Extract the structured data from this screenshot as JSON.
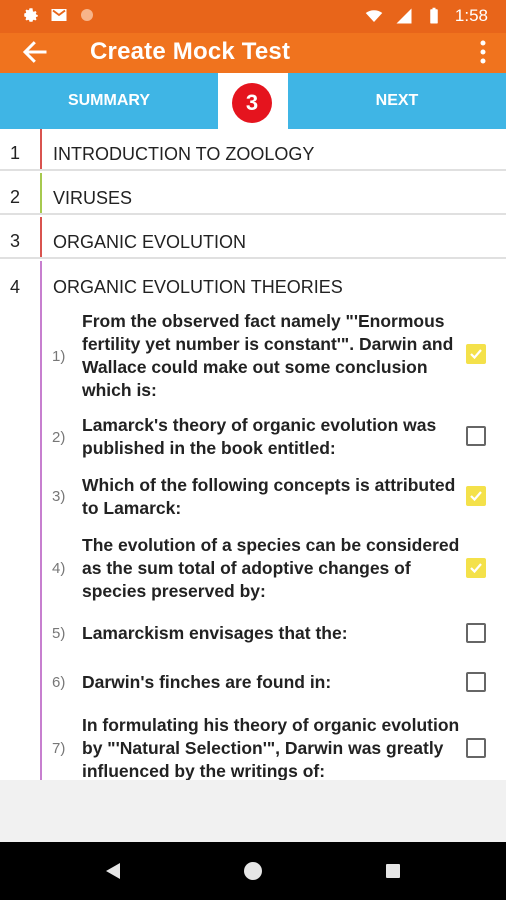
{
  "status_bar": {
    "time": "1:58",
    "icons_left": [
      "gear-icon",
      "gmail-icon",
      "dot-icon"
    ],
    "icons_right": [
      "wifi-icon",
      "signal-icon",
      "battery-icon"
    ]
  },
  "app_bar": {
    "title": "Create Mock Test",
    "back_icon": "arrow-left-icon",
    "menu_icon": "more-vert-icon"
  },
  "tabs": {
    "summary_label": "SUMMARY",
    "badge_count": "3",
    "next_label": "NEXT"
  },
  "chapters": [
    {
      "number": "1",
      "title": "INTRODUCTION TO ZOOLOGY",
      "bar_color": "#d9534f"
    },
    {
      "number": "2",
      "title": "VIRUSES",
      "bar_color": "#a6c94f"
    },
    {
      "number": "3",
      "title": "ORGANIC EVOLUTION",
      "bar_color": "#d9534f"
    },
    {
      "number": "4",
      "title": "ORGANIC EVOLUTION THEORIES",
      "bar_color": "#c77fcf"
    }
  ],
  "questions": [
    {
      "number": "1)",
      "text": "From the observed fact namely \"'Enormous fertility yet number is constant'\". Darwin and Wallace could make out some conclusion which is:",
      "checked": true
    },
    {
      "number": "2)",
      "text": "Lamarck's theory of organic evolution was published in the book entitled:",
      "checked": false
    },
    {
      "number": "3)",
      "text": "Which of the following concepts is attributed to Lamarck:",
      "checked": true
    },
    {
      "number": "4)",
      "text": "The evolution of a species can be considered as the sum total of adoptive changes of species preserved by:",
      "checked": true
    },
    {
      "number": "5)",
      "text": "Lamarckism envisages that the:",
      "checked": false
    },
    {
      "number": "6)",
      "text": "Darwin's finches are found in:",
      "checked": false
    },
    {
      "number": "7)",
      "text": "In formulating his theory of organic evolution by \"'Natural Selection'\", Darwin was greatly influenced by the writings of:",
      "checked": false
    }
  ],
  "colors": {
    "status_bar": "#e8651a",
    "app_bar": "#f0731e",
    "tab_bar": "#3fb5e5",
    "badge": "#e5141e",
    "checkbox_checked": "#f4e14a"
  }
}
